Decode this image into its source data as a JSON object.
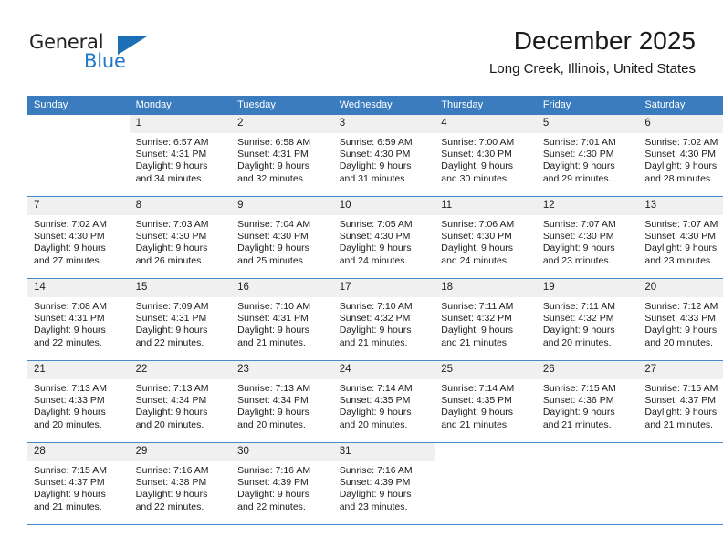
{
  "brand": {
    "name_part1": "General",
    "name_part2": "Blue",
    "accent_color": "#2277c8",
    "triangle_color": "#1a6fb5"
  },
  "header": {
    "title": "December 2025",
    "location": "Long Creek, Illinois, United States"
  },
  "calendar": {
    "header_bg": "#3a7cbe",
    "daynum_bg": "#f0f0f0",
    "weekdays": [
      "Sunday",
      "Monday",
      "Tuesday",
      "Wednesday",
      "Thursday",
      "Friday",
      "Saturday"
    ],
    "weeks": [
      [
        {
          "day": "",
          "blank": true,
          "sunrise": "",
          "sunset": "",
          "daylight1": "",
          "daylight2": ""
        },
        {
          "day": "1",
          "sunrise": "Sunrise: 6:57 AM",
          "sunset": "Sunset: 4:31 PM",
          "daylight1": "Daylight: 9 hours",
          "daylight2": "and 34 minutes."
        },
        {
          "day": "2",
          "sunrise": "Sunrise: 6:58 AM",
          "sunset": "Sunset: 4:31 PM",
          "daylight1": "Daylight: 9 hours",
          "daylight2": "and 32 minutes."
        },
        {
          "day": "3",
          "sunrise": "Sunrise: 6:59 AM",
          "sunset": "Sunset: 4:30 PM",
          "daylight1": "Daylight: 9 hours",
          "daylight2": "and 31 minutes."
        },
        {
          "day": "4",
          "sunrise": "Sunrise: 7:00 AM",
          "sunset": "Sunset: 4:30 PM",
          "daylight1": "Daylight: 9 hours",
          "daylight2": "and 30 minutes."
        },
        {
          "day": "5",
          "sunrise": "Sunrise: 7:01 AM",
          "sunset": "Sunset: 4:30 PM",
          "daylight1": "Daylight: 9 hours",
          "daylight2": "and 29 minutes."
        },
        {
          "day": "6",
          "sunrise": "Sunrise: 7:02 AM",
          "sunset": "Sunset: 4:30 PM",
          "daylight1": "Daylight: 9 hours",
          "daylight2": "and 28 minutes."
        }
      ],
      [
        {
          "day": "7",
          "sunrise": "Sunrise: 7:02 AM",
          "sunset": "Sunset: 4:30 PM",
          "daylight1": "Daylight: 9 hours",
          "daylight2": "and 27 minutes."
        },
        {
          "day": "8",
          "sunrise": "Sunrise: 7:03 AM",
          "sunset": "Sunset: 4:30 PM",
          "daylight1": "Daylight: 9 hours",
          "daylight2": "and 26 minutes."
        },
        {
          "day": "9",
          "sunrise": "Sunrise: 7:04 AM",
          "sunset": "Sunset: 4:30 PM",
          "daylight1": "Daylight: 9 hours",
          "daylight2": "and 25 minutes."
        },
        {
          "day": "10",
          "sunrise": "Sunrise: 7:05 AM",
          "sunset": "Sunset: 4:30 PM",
          "daylight1": "Daylight: 9 hours",
          "daylight2": "and 24 minutes."
        },
        {
          "day": "11",
          "sunrise": "Sunrise: 7:06 AM",
          "sunset": "Sunset: 4:30 PM",
          "daylight1": "Daylight: 9 hours",
          "daylight2": "and 24 minutes."
        },
        {
          "day": "12",
          "sunrise": "Sunrise: 7:07 AM",
          "sunset": "Sunset: 4:30 PM",
          "daylight1": "Daylight: 9 hours",
          "daylight2": "and 23 minutes."
        },
        {
          "day": "13",
          "sunrise": "Sunrise: 7:07 AM",
          "sunset": "Sunset: 4:30 PM",
          "daylight1": "Daylight: 9 hours",
          "daylight2": "and 23 minutes."
        }
      ],
      [
        {
          "day": "14",
          "sunrise": "Sunrise: 7:08 AM",
          "sunset": "Sunset: 4:31 PM",
          "daylight1": "Daylight: 9 hours",
          "daylight2": "and 22 minutes."
        },
        {
          "day": "15",
          "sunrise": "Sunrise: 7:09 AM",
          "sunset": "Sunset: 4:31 PM",
          "daylight1": "Daylight: 9 hours",
          "daylight2": "and 22 minutes."
        },
        {
          "day": "16",
          "sunrise": "Sunrise: 7:10 AM",
          "sunset": "Sunset: 4:31 PM",
          "daylight1": "Daylight: 9 hours",
          "daylight2": "and 21 minutes."
        },
        {
          "day": "17",
          "sunrise": "Sunrise: 7:10 AM",
          "sunset": "Sunset: 4:32 PM",
          "daylight1": "Daylight: 9 hours",
          "daylight2": "and 21 minutes."
        },
        {
          "day": "18",
          "sunrise": "Sunrise: 7:11 AM",
          "sunset": "Sunset: 4:32 PM",
          "daylight1": "Daylight: 9 hours",
          "daylight2": "and 21 minutes."
        },
        {
          "day": "19",
          "sunrise": "Sunrise: 7:11 AM",
          "sunset": "Sunset: 4:32 PM",
          "daylight1": "Daylight: 9 hours",
          "daylight2": "and 20 minutes."
        },
        {
          "day": "20",
          "sunrise": "Sunrise: 7:12 AM",
          "sunset": "Sunset: 4:33 PM",
          "daylight1": "Daylight: 9 hours",
          "daylight2": "and 20 minutes."
        }
      ],
      [
        {
          "day": "21",
          "sunrise": "Sunrise: 7:13 AM",
          "sunset": "Sunset: 4:33 PM",
          "daylight1": "Daylight: 9 hours",
          "daylight2": "and 20 minutes."
        },
        {
          "day": "22",
          "sunrise": "Sunrise: 7:13 AM",
          "sunset": "Sunset: 4:34 PM",
          "daylight1": "Daylight: 9 hours",
          "daylight2": "and 20 minutes."
        },
        {
          "day": "23",
          "sunrise": "Sunrise: 7:13 AM",
          "sunset": "Sunset: 4:34 PM",
          "daylight1": "Daylight: 9 hours",
          "daylight2": "and 20 minutes."
        },
        {
          "day": "24",
          "sunrise": "Sunrise: 7:14 AM",
          "sunset": "Sunset: 4:35 PM",
          "daylight1": "Daylight: 9 hours",
          "daylight2": "and 20 minutes."
        },
        {
          "day": "25",
          "sunrise": "Sunrise: 7:14 AM",
          "sunset": "Sunset: 4:35 PM",
          "daylight1": "Daylight: 9 hours",
          "daylight2": "and 21 minutes."
        },
        {
          "day": "26",
          "sunrise": "Sunrise: 7:15 AM",
          "sunset": "Sunset: 4:36 PM",
          "daylight1": "Daylight: 9 hours",
          "daylight2": "and 21 minutes."
        },
        {
          "day": "27",
          "sunrise": "Sunrise: 7:15 AM",
          "sunset": "Sunset: 4:37 PM",
          "daylight1": "Daylight: 9 hours",
          "daylight2": "and 21 minutes."
        }
      ],
      [
        {
          "day": "28",
          "sunrise": "Sunrise: 7:15 AM",
          "sunset": "Sunset: 4:37 PM",
          "daylight1": "Daylight: 9 hours",
          "daylight2": "and 21 minutes."
        },
        {
          "day": "29",
          "sunrise": "Sunrise: 7:16 AM",
          "sunset": "Sunset: 4:38 PM",
          "daylight1": "Daylight: 9 hours",
          "daylight2": "and 22 minutes."
        },
        {
          "day": "30",
          "sunrise": "Sunrise: 7:16 AM",
          "sunset": "Sunset: 4:39 PM",
          "daylight1": "Daylight: 9 hours",
          "daylight2": "and 22 minutes."
        },
        {
          "day": "31",
          "sunrise": "Sunrise: 7:16 AM",
          "sunset": "Sunset: 4:39 PM",
          "daylight1": "Daylight: 9 hours",
          "daylight2": "and 23 minutes."
        },
        {
          "day": "",
          "blank": true,
          "sunrise": "",
          "sunset": "",
          "daylight1": "",
          "daylight2": ""
        },
        {
          "day": "",
          "blank": true,
          "sunrise": "",
          "sunset": "",
          "daylight1": "",
          "daylight2": ""
        },
        {
          "day": "",
          "blank": true,
          "sunrise": "",
          "sunset": "",
          "daylight1": "",
          "daylight2": ""
        }
      ]
    ]
  }
}
